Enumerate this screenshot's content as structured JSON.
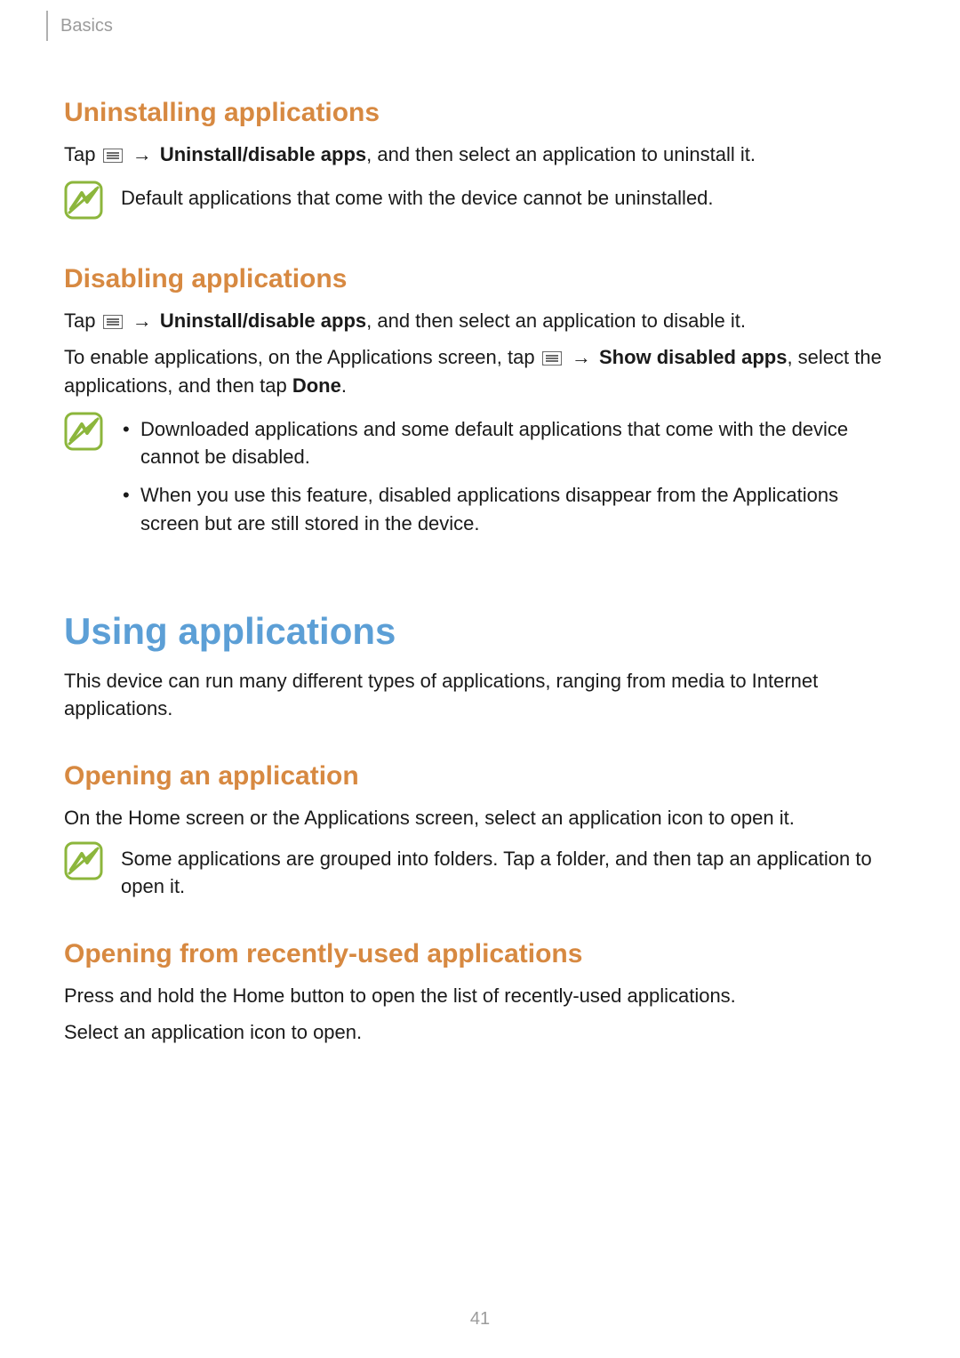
{
  "header": {
    "section": "Basics"
  },
  "page_number": "41",
  "sections": {
    "uninstalling": {
      "title": "Uninstalling applications",
      "line1_pre": "Tap ",
      "line1_arrow": "→",
      "line1_bold": "Uninstall/disable apps",
      "line1_post": ", and then select an application to uninstall it.",
      "note": "Default applications that come with the device cannot be uninstalled."
    },
    "disabling": {
      "title": "Disabling applications",
      "line1_pre": "Tap ",
      "line1_arrow": "→",
      "line1_bold": "Uninstall/disable apps",
      "line1_post": ", and then select an application to disable it.",
      "line2_pre": "To enable applications, on the Applications screen, tap ",
      "line2_arrow": "→",
      "line2_bold1": "Show disabled apps",
      "line2_mid": ", select the applications, and then tap ",
      "line2_bold2": "Done",
      "line2_post": ".",
      "notes": [
        "Downloaded applications and some default applications that come with the device cannot be disabled.",
        "When you use this feature, disabled applications disappear from the Applications screen but are still stored in the device."
      ]
    },
    "using": {
      "title": "Using applications",
      "intro": "This device can run many different types of applications, ranging from media to Internet applications."
    },
    "opening": {
      "title": "Opening an application",
      "body": "On the Home screen or the Applications screen, select an application icon to open it.",
      "note": "Some applications are grouped into folders. Tap a folder, and then tap an application to open it."
    },
    "recent": {
      "title": "Opening from recently-used applications",
      "line1": "Press and hold the Home button to open the list of recently-used applications.",
      "line2": "Select an application icon to open."
    }
  }
}
